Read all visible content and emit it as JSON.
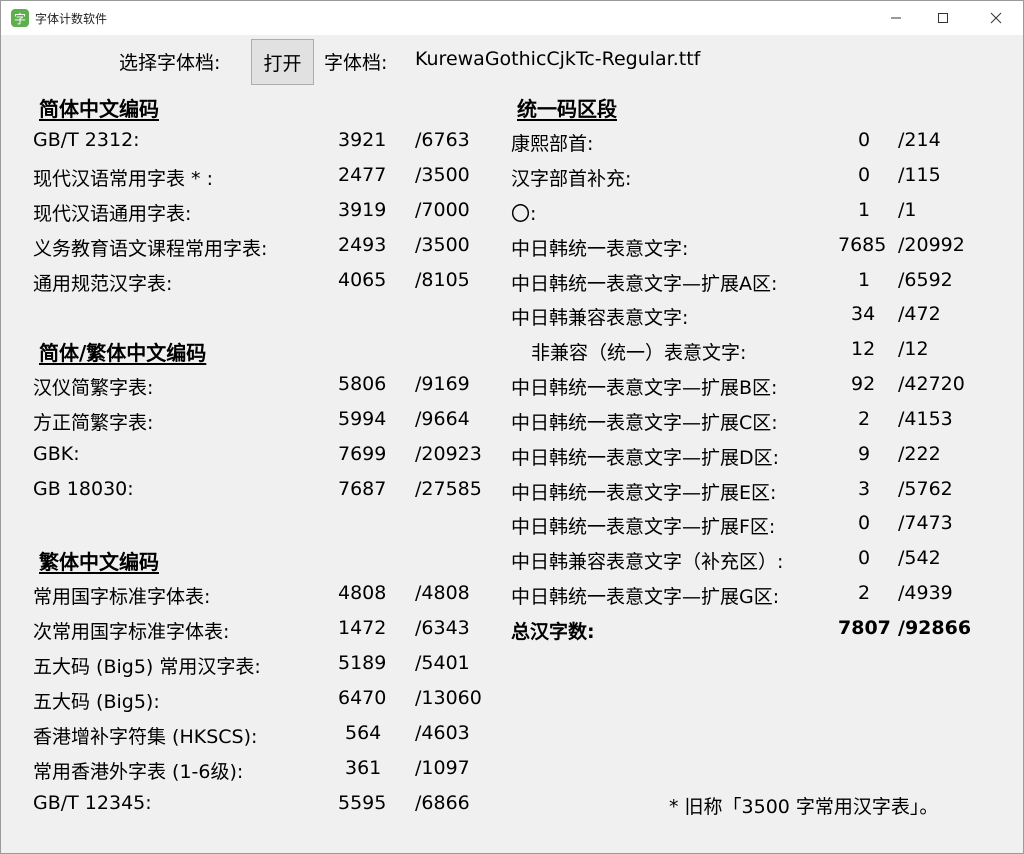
{
  "window": {
    "title": "字体计数软件"
  },
  "toolbar": {
    "select_label": "选择字体档:",
    "open_button": "打开",
    "font_label": "字体档:",
    "font_file": "KurewaGothicCjkTc-Regular.ttf"
  },
  "simplified": {
    "heading": "简体中文编码",
    "rows": [
      {
        "label": "GB/T 2312:",
        "count": "3921",
        "total": "/6763"
      },
      {
        "label": "现代汉语常用字表 * :",
        "count": "2477",
        "total": "/3500"
      },
      {
        "label": "现代汉语通用字表:",
        "count": "3919",
        "total": "/7000"
      },
      {
        "label": "义务教育语文课程常用字表:",
        "count": "2493",
        "total": "/3500"
      },
      {
        "label": "通用规范汉字表:",
        "count": "4065",
        "total": "/8105"
      }
    ]
  },
  "mixed": {
    "heading": "简体/繁体中文编码",
    "rows": [
      {
        "label": "汉仪简繁字表:",
        "count": "5806",
        "total": "/9169"
      },
      {
        "label": "方正简繁字表:",
        "count": "5994",
        "total": "/9664"
      },
      {
        "label": "GBK:",
        "count": "7699",
        "total": "/20923"
      },
      {
        "label": "GB 18030:",
        "count": "7687",
        "total": "/27585"
      }
    ]
  },
  "traditional": {
    "heading": "繁体中文编码",
    "rows": [
      {
        "label": "常用国字标准字体表:",
        "count": "4808",
        "total": "/4808"
      },
      {
        "label": "次常用国字标准字体表:",
        "count": "1472",
        "total": "/6343"
      },
      {
        "label": "五大码 (Big5) 常用汉字表:",
        "count": "5189",
        "total": "/5401"
      },
      {
        "label": "五大码 (Big5):",
        "count": "6470",
        "total": "/13060"
      },
      {
        "label": "香港增补字符集 (HKSCS):",
        "count": "564",
        "total": "/4603"
      },
      {
        "label": "常用香港外字表 (1-6级):",
        "count": "361",
        "total": "/1097"
      },
      {
        "label": "GB/T 12345:",
        "count": "5595",
        "total": "/6866"
      }
    ]
  },
  "unicode": {
    "heading": "统一码区段",
    "rows": [
      {
        "label": "康熙部首:",
        "count": "0",
        "total": "/214"
      },
      {
        "label": "汉字部首补充:",
        "count": "0",
        "total": "/115"
      },
      {
        "label": "〇:",
        "count": "1",
        "total": "/1"
      },
      {
        "label": "中日韩统一表意文字:",
        "count": "7685",
        "total": "/20992"
      },
      {
        "label": "中日韩统一表意文字—扩展A区:",
        "count": "1",
        "total": "/6592"
      },
      {
        "label": "中日韩兼容表意文字:",
        "count": "34",
        "total": "/472"
      },
      {
        "label": "非兼容（统一）表意文字:",
        "count": "12",
        "total": "/12"
      },
      {
        "label": "中日韩统一表意文字—扩展B区:",
        "count": "92",
        "total": "/42720"
      },
      {
        "label": "中日韩统一表意文字—扩展C区:",
        "count": "2",
        "total": "/4153"
      },
      {
        "label": "中日韩统一表意文字—扩展D区:",
        "count": "9",
        "total": "/222"
      },
      {
        "label": "中日韩统一表意文字—扩展E区:",
        "count": "3",
        "total": "/5762"
      },
      {
        "label": "中日韩统一表意文字—扩展F区:",
        "count": "0",
        "total": "/7473"
      },
      {
        "label": "中日韩兼容表意文字（补充区）:",
        "count": "0",
        "total": "/542"
      },
      {
        "label": "中日韩统一表意文字—扩展G区:",
        "count": "2",
        "total": "/4939"
      }
    ],
    "total": {
      "label": "总汉字数:",
      "count": "7807",
      "total": "/92866"
    }
  },
  "footnote": "* 旧称「3500 字常用汉字表」。"
}
